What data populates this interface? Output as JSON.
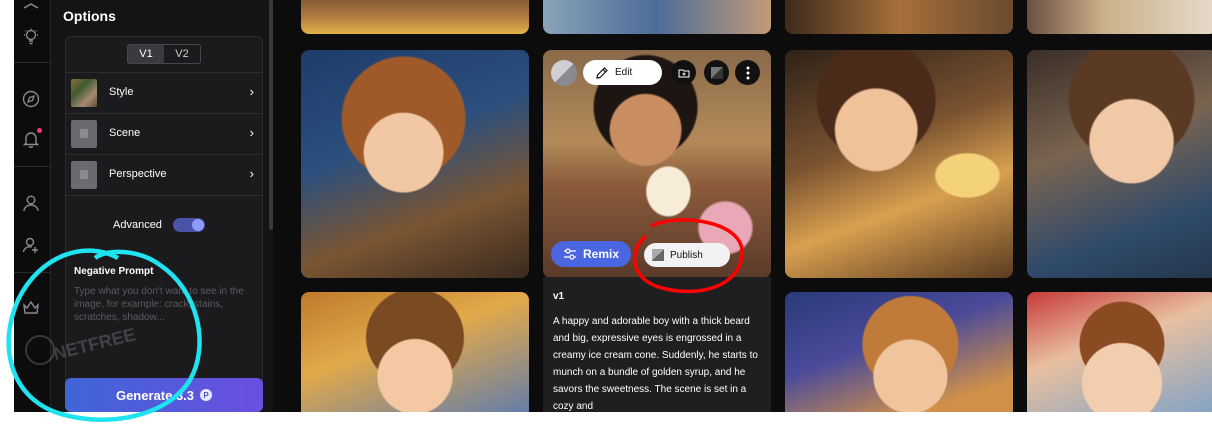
{
  "panel": {
    "title": "Options",
    "versions": [
      "V1",
      "V2"
    ],
    "rows": [
      {
        "label": "Style"
      },
      {
        "label": "Scene"
      },
      {
        "label": "Perspective"
      }
    ],
    "advanced_label": "Advanced",
    "negative_prompt_title": "Negative Prompt",
    "negative_prompt_placeholder": "Type what you don't want to see in the image, for example: crack, stains, scratches, shadow...",
    "generate_label": "Generate 3.3"
  },
  "selected_image": {
    "edit_label": "Edit",
    "remix_label": "Remix",
    "publish_label": "Publish",
    "version": "v1",
    "description": "A happy and adorable boy with a thick beard and big, expressive eyes is engrossed in a creamy ice cream cone. Suddenly, he starts to munch on a bundle of golden syrup, and he savors the sweetness. The scene is set in a cozy and"
  },
  "watermark": "NETFREE",
  "colors": {
    "accent": "#6a4fe0",
    "remix": "#4a66e0",
    "notification": "#ff3b6b",
    "annotation_red": "#ff0000",
    "annotation_cyan": "#1fe3ee"
  }
}
